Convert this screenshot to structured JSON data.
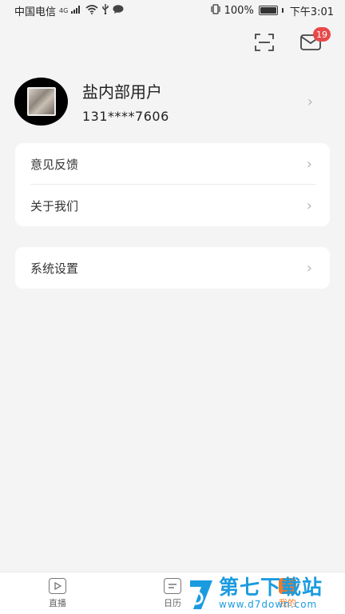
{
  "status_bar": {
    "carrier": "中国电信",
    "network": "4G",
    "battery": "100%",
    "time": "下午3:01"
  },
  "header": {
    "scan_icon": "scan-icon",
    "message_icon": "mail-icon",
    "message_badge": "19"
  },
  "profile": {
    "name": "盐内部用户",
    "phone": "131****7606"
  },
  "menu_group_1": [
    {
      "label": "意见反馈"
    },
    {
      "label": "关于我们"
    }
  ],
  "menu_group_2": [
    {
      "label": "系统设置"
    }
  ],
  "tabs": [
    {
      "label": "直播",
      "icon": "play-icon"
    },
    {
      "label": "日历",
      "icon": "calendar-icon"
    },
    {
      "label": "我的",
      "icon": "user-icon"
    }
  ],
  "watermark": {
    "title": "第七下载站",
    "url": "www.d7down.com"
  },
  "colors": {
    "accent": "#f07b2a",
    "badge": "#e84a4a",
    "watermark": "#1a9be0",
    "background": "#f4f4f4"
  }
}
